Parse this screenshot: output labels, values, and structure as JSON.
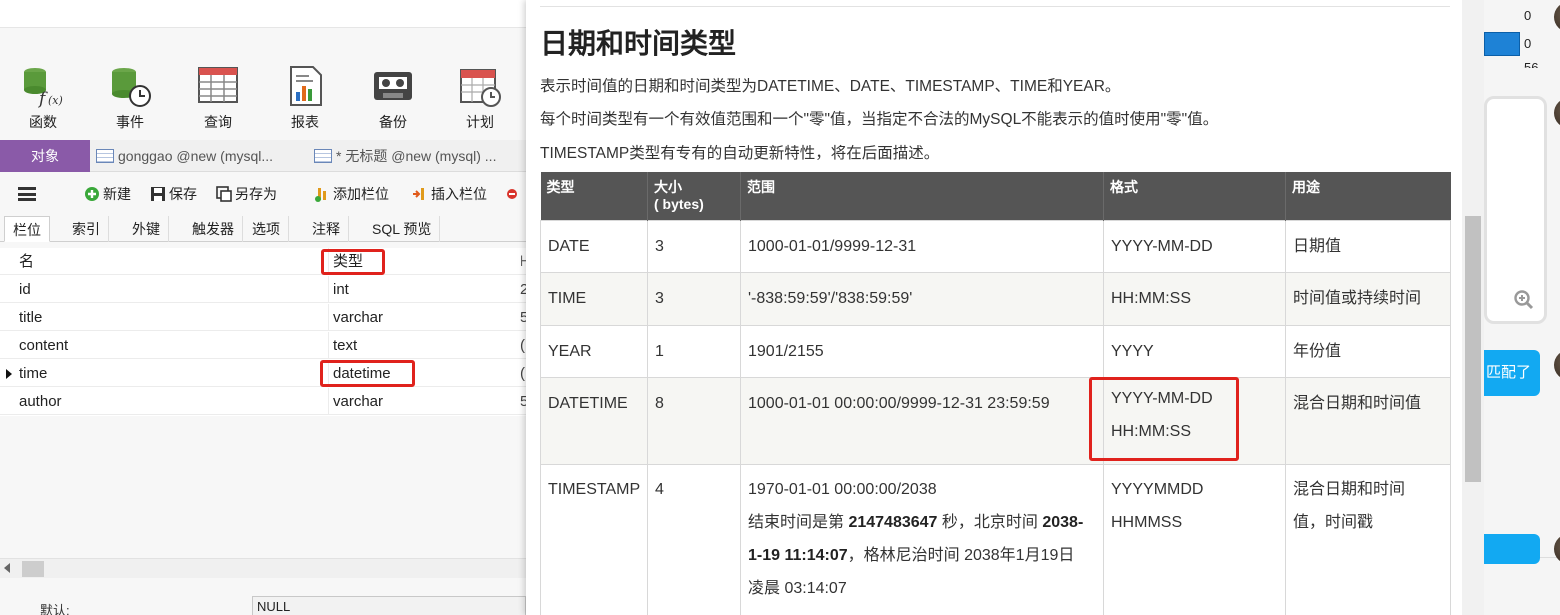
{
  "app": {
    "toolbar": [
      {
        "label": "函数",
        "icon": "function-icon"
      },
      {
        "label": "事件",
        "icon": "event-icon"
      },
      {
        "label": "查询",
        "icon": "query-icon"
      },
      {
        "label": "报表",
        "icon": "report-icon"
      },
      {
        "label": "备份",
        "icon": "backup-icon"
      },
      {
        "label": "计划",
        "icon": "schedule-icon"
      }
    ],
    "tabs": {
      "object": "对象",
      "doc1": "gonggao @new (mysql...",
      "doc2": "* 无标题 @new (mysql) ..."
    },
    "actions": {
      "new": "新建",
      "save": "保存",
      "save_as": "另存为",
      "add_field": "添加栏位",
      "insert_field": "插入栏位"
    },
    "subtabs": [
      "栏位",
      "索引",
      "外键",
      "触发器",
      "选项",
      "注释",
      "SQL 预览"
    ],
    "grid": {
      "col_name": "名",
      "col_type": "类型",
      "rows": [
        {
          "name": "id",
          "type": "int",
          "extra": "2"
        },
        {
          "name": "title",
          "type": "varchar",
          "extra": "5"
        },
        {
          "name": "content",
          "type": "text",
          "extra": "("
        },
        {
          "name": "time",
          "type": "datetime",
          "extra": "("
        },
        {
          "name": "author",
          "type": "varchar",
          "extra": "5"
        }
      ]
    },
    "default_label": "默认:",
    "default_value": "NULL"
  },
  "doc": {
    "title": "日期和时间类型",
    "p1": "表示时间值的日期和时间类型为DATETIME、DATE、TIMESTAMP、TIME和YEAR。",
    "p2": "每个时间类型有一个有效值范围和一个\"零\"值，当指定不合法的MySQL不能表示的值时使用\"零\"值。",
    "p3": "TIMESTAMP类型有专有的自动更新特性，将在后面描述。",
    "headers": {
      "type": "类型",
      "size1": "大小",
      "size2": "( bytes)",
      "range": "范围",
      "format": "格式",
      "use": "用途"
    },
    "rows": [
      {
        "type": "DATE",
        "size": "3",
        "range": "1000-01-01/9999-12-31",
        "format": "YYYY-MM-DD",
        "use": "日期值"
      },
      {
        "type": "TIME",
        "size": "3",
        "range": "'-838:59:59'/'838:59:59'",
        "format": "HH:MM:SS",
        "use": "时间值或持续时间"
      },
      {
        "type": "YEAR",
        "size": "1",
        "range": "1901/2155",
        "format": "YYYY",
        "use": "年份值"
      },
      {
        "type": "DATETIME",
        "size": "8",
        "range": "1000-01-01 00:00:00/9999-12-31 23:59:59",
        "format1": "YYYY-MM-DD",
        "format2": "HH:MM:SS",
        "use": "混合日期和时间值"
      },
      {
        "type": "TIMESTAMP",
        "size": "4",
        "range1": "1970-01-01 00:00:00/2038",
        "range2a": "结束时间是第 ",
        "range2b": "2147483647",
        "range2c": " 秒，北京时间 ",
        "range2d": "2038-",
        "range3a": "1-19 11:14:07",
        "range3b": "，格林尼治时间 2038年1月19日",
        "range4": "凌晨 03:14:07",
        "format1": "YYYYMMDD",
        "format2": "HHMMSS",
        "use1": "混合日期和时间",
        "use2": "值，时间戳"
      }
    ]
  },
  "chat": {
    "n1": "0",
    "n2": "0",
    "n3": "56",
    "bubble": "匹配了"
  }
}
